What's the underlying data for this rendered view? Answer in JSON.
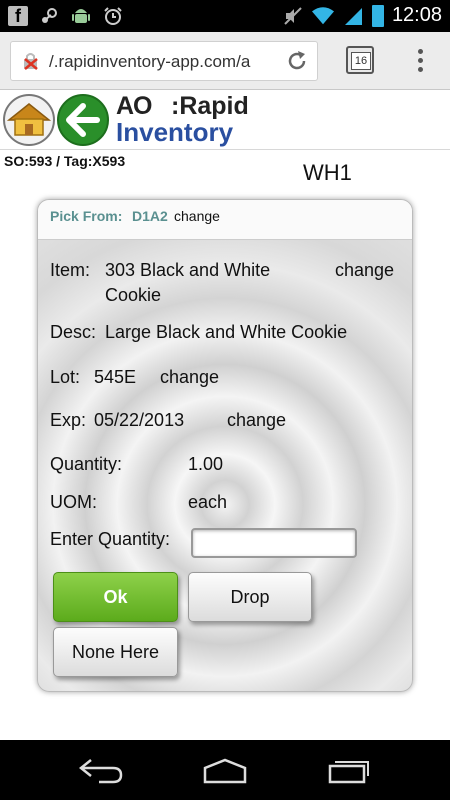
{
  "statusbar": {
    "icons": [
      "facebook-icon",
      "steam-icon",
      "android-icon",
      "alarm-icon",
      "mute-icon",
      "wifi-icon",
      "signal-icon",
      "battery-icon"
    ],
    "time": "12:08"
  },
  "browser": {
    "url": "/.rapidinventory-app.com/a",
    "tab_count": "16"
  },
  "app": {
    "logo_ao": "AO",
    "logo_rapid": ":Rapid",
    "logo_inventory": "Inventory"
  },
  "order": {
    "so_tag": "SO:593 / Tag:X593",
    "warehouse": "WH1"
  },
  "pick": {
    "pick_from_label": "Pick From:",
    "pick_from_location": "D1A2",
    "pick_from_change": "change",
    "item_label": "Item:",
    "item_line1": "303 Black and White",
    "item_line2": "Cookie",
    "item_change": "change",
    "desc_label": "Desc:",
    "desc_value": "Large Black and White Cookie",
    "lot_label": "Lot:",
    "lot_value": "545E",
    "lot_change": "change",
    "exp_label": "Exp:",
    "exp_value": "05/22/2013",
    "exp_change": "change",
    "quantity_label": "Quantity:",
    "quantity_value": "1.00",
    "uom_label": "UOM:",
    "uom_value": "each",
    "enter_quantity_label": "Enter Quantity:",
    "enter_quantity_value": ""
  },
  "buttons": {
    "ok": "Ok",
    "drop": "Drop",
    "none_here": "None Here"
  },
  "colors": {
    "ok_button": "#6abb26",
    "pick_from": "#5a9090",
    "inventory_logo": "#2a4fa0",
    "back_button": "#2a8f2a"
  }
}
